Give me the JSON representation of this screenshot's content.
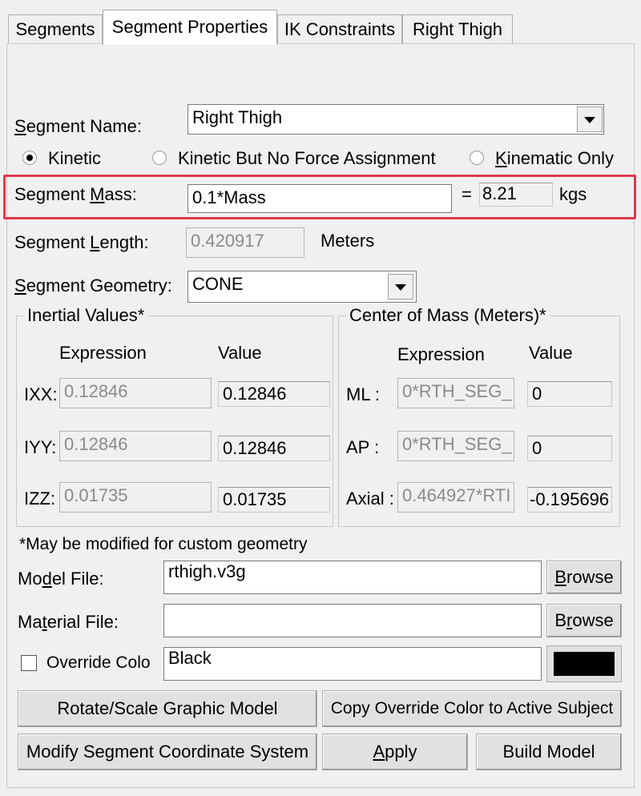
{
  "tabs": [
    {
      "label": "Segments",
      "active": false
    },
    {
      "label": "Segment Properties",
      "active": true
    },
    {
      "label": "IK Constraints",
      "active": false
    },
    {
      "label": "Right Thigh",
      "active": false
    }
  ],
  "segment_name": {
    "label_u": "S",
    "label_rest": "egment Name:",
    "value": "Right Thigh"
  },
  "modes": [
    {
      "label": "Kinetic",
      "checked": true
    },
    {
      "label": "Kinetic But No Force Assignment",
      "checked": false
    },
    {
      "label_u": "K",
      "label_rest": "inematic Only",
      "checked": false
    }
  ],
  "mass": {
    "label_pre": "Segment ",
    "label_u": "M",
    "label_rest": "ass:",
    "expression": "0.1*Mass",
    "equals": "=",
    "result": "8.21",
    "unit": "kgs"
  },
  "length": {
    "label_pre": "Segment ",
    "label_u": "L",
    "label_rest": "ength:",
    "value": "0.420917",
    "unit": "Meters"
  },
  "geometry": {
    "label_u": "S",
    "label_rest": "egment Geometry:",
    "value": "CONE"
  },
  "inertial": {
    "title": "Inertial Values*",
    "col_expression": "Expression",
    "col_value": "Value",
    "rows": [
      {
        "label": "IXX:",
        "expression": "0.12846",
        "value": "0.12846"
      },
      {
        "label": "IYY:",
        "expression": "0.12846",
        "value": "0.12846"
      },
      {
        "label": "IZZ:",
        "expression": "0.01735",
        "value": "0.01735"
      }
    ]
  },
  "com": {
    "title": "Center of Mass (Meters)*",
    "col_expression": "Expression",
    "col_value": "Value",
    "rows": [
      {
        "label": "ML :",
        "expression": "0*RTH_SEG_",
        "value": "0"
      },
      {
        "label": "AP :",
        "expression": "0*RTH_SEG_",
        "value": "0"
      },
      {
        "label": "Axial :",
        "expression": "0.464927*RTI",
        "value": "-0.195696"
      }
    ]
  },
  "note": "*May be modified for custom geometry",
  "model_file": {
    "label_pre": "Mo",
    "label_u": "d",
    "label_rest": "el File:",
    "value": "rthigh.v3g",
    "browse_u": "B",
    "browse_rest": "rowse"
  },
  "material_file": {
    "label_pre": "Ma",
    "label_u": "t",
    "label_rest": "erial File:",
    "value": "",
    "browse_pre": "B",
    "browse_u": "r",
    "browse_rest": "owse"
  },
  "override_color": {
    "label": "Override Colo",
    "value": "Black",
    "checked": false,
    "swatch_color": "#000000"
  },
  "buttons": {
    "rotate_scale": "Rotate/Scale Graphic Model",
    "copy_override": "Copy Override Color to Active Subject",
    "modify_coords": "Modify Segment Coordinate System",
    "apply_u": "A",
    "apply_rest": "pply",
    "build_model": "Build Model"
  },
  "colors": {
    "highlight": "#e0384b",
    "panel_bg": "#f0f0f0"
  }
}
